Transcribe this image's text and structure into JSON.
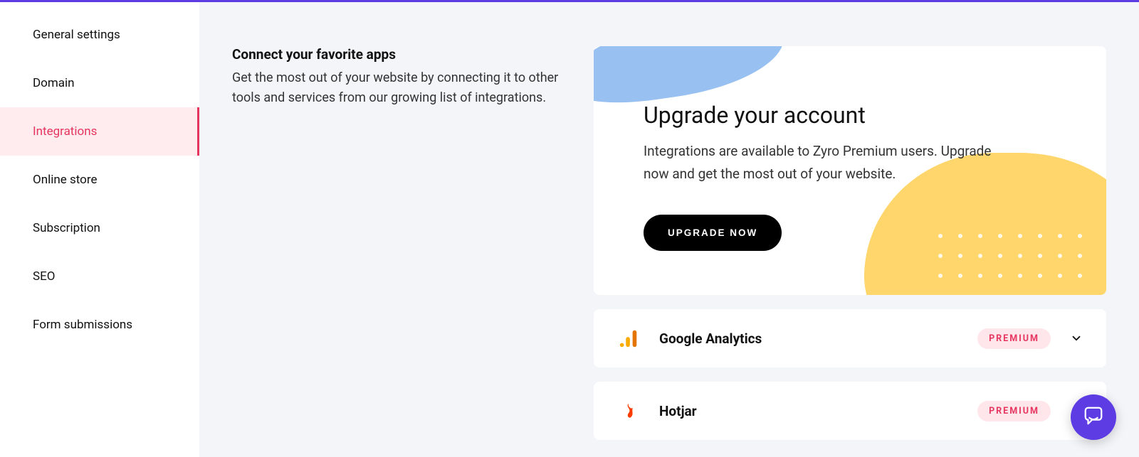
{
  "sidebar": {
    "items": [
      {
        "label": "General settings",
        "active": false
      },
      {
        "label": "Domain",
        "active": false
      },
      {
        "label": "Integrations",
        "active": true
      },
      {
        "label": "Online store",
        "active": false
      },
      {
        "label": "Subscription",
        "active": false
      },
      {
        "label": "SEO",
        "active": false
      },
      {
        "label": "Form submissions",
        "active": false
      }
    ]
  },
  "intro": {
    "heading": "Connect your favorite apps",
    "body": "Get the most out of your website by connecting it to other tools and services from our growing list of integrations."
  },
  "upgrade": {
    "title": "Upgrade your account",
    "body": "Integrations are available to Zyro Premium users. Upgrade now and get the most out of your website.",
    "cta": "UPGRADE NOW"
  },
  "integrations": [
    {
      "name": "Google Analytics",
      "badge": "PREMIUM",
      "icon": "google-analytics"
    },
    {
      "name": "Hotjar",
      "badge": "PREMIUM",
      "icon": "hotjar"
    }
  ],
  "colors": {
    "accent_purple": "#5d3ce4",
    "active_pink_bg": "#ffecee",
    "active_pink_fg": "#e6355f",
    "badge_bg": "#ffe6ea",
    "badge_fg": "#e6355f",
    "blob_blue": "#98c1f2",
    "blob_yellow": "#ffd66b",
    "cta_bg": "#000000"
  }
}
